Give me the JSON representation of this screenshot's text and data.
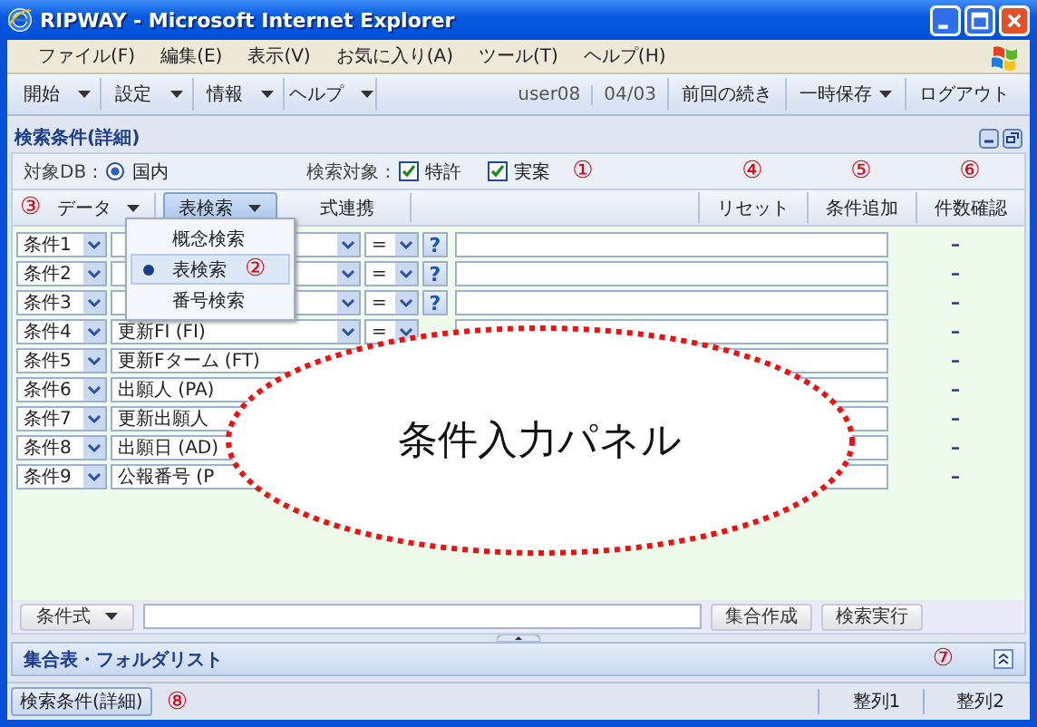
{
  "window": {
    "title": "RIPWAY - Microsoft Internet Explorer"
  },
  "menu": [
    "ファイル(F)",
    "編集(E)",
    "表示(V)",
    "お気に入り(A)",
    "ツール(T)",
    "ヘルプ(H)"
  ],
  "toolbar": {
    "menus": [
      {
        "label": "開始",
        "dropdown": true
      },
      {
        "label": "設定",
        "dropdown": true
      },
      {
        "label": "情報",
        "dropdown": true
      },
      {
        "label": "ヘルプ",
        "dropdown": true
      }
    ],
    "user": "user08",
    "date": "04/03",
    "actions": [
      {
        "label": "前回の続き",
        "dropdown": false
      },
      {
        "label": "一時保存",
        "dropdown": true
      },
      {
        "label": "ログアウト",
        "dropdown": false
      }
    ]
  },
  "panel": {
    "title": "検索条件(詳細)",
    "target_db": {
      "label": "対象DB :",
      "options": [
        {
          "label": "国内",
          "selected": true
        }
      ]
    },
    "search_target": {
      "label": "検索対象 :",
      "options": [
        {
          "label": "特許",
          "checked": true
        },
        {
          "label": "実案",
          "checked": true
        }
      ],
      "marker": "①"
    },
    "tabs_marker": "③",
    "tabs": [
      {
        "label": "データ",
        "dropdown": true,
        "selected": false
      },
      {
        "label": "表検索",
        "dropdown": true,
        "selected": true
      },
      {
        "label": "式連携",
        "dropdown": false,
        "selected": false
      }
    ],
    "actions": [
      {
        "label": "リセット",
        "marker": "④"
      },
      {
        "label": "条件追加",
        "marker": "⑤"
      },
      {
        "label": "件数確認",
        "marker": "⑥"
      }
    ],
    "menu": [
      {
        "label": "概念検索",
        "selected": false
      },
      {
        "label": "表検索",
        "selected": true,
        "marker": "②"
      },
      {
        "label": "番号検索",
        "selected": false
      }
    ],
    "conditions": [
      {
        "name": "条件1",
        "operator": "=",
        "help": "?",
        "count": "–"
      },
      {
        "name": "条件2",
        "operator": "=",
        "help": "?",
        "count": "–"
      },
      {
        "name": "条件3",
        "operator": "=",
        "help": "?",
        "count": "–"
      },
      {
        "name": "条件4",
        "field": "更新FI (FI)",
        "operator": "=",
        "count": "–"
      },
      {
        "name": "条件5",
        "field": "更新Fターム (FT)",
        "count": "–"
      },
      {
        "name": "条件6",
        "field": "出願人 (PA)",
        "count": "–"
      },
      {
        "name": "条件7",
        "field": "更新出願人",
        "count": "–"
      },
      {
        "name": "条件8",
        "field": "出願日 (AD)",
        "count": "–"
      },
      {
        "name": "条件9",
        "field": "公報番号 (P",
        "count": "–"
      }
    ],
    "callout": "条件入力パネル",
    "expression": {
      "label": "条件式",
      "dropdown": true
    },
    "buttons": [
      "集合作成",
      "検索実行"
    ]
  },
  "section": {
    "title": "集合表・フォルダリスト",
    "marker": "⑦"
  },
  "status_bar": {
    "button": "検索条件(詳細)",
    "marker": "⑧",
    "items": [
      "整列1",
      "整列2"
    ]
  }
}
